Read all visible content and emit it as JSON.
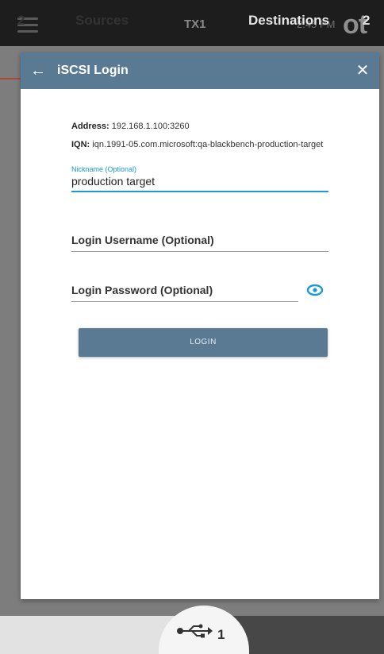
{
  "appbar": {
    "device_name": "TX1",
    "time": "2:45 PM",
    "logo_text": "ot"
  },
  "dialog": {
    "title": "iSCSI Login",
    "address_label": "Address:",
    "address_value": "192.168.1.100:3260",
    "iqn_label": "IQN:",
    "iqn_value": "iqn.1991-05.com.microsoft:qa-blackbench-production-target",
    "nickname": {
      "label": "Nickname (Optional)",
      "value": "production target"
    },
    "username": {
      "label": "Login Username (Optional)",
      "value": ""
    },
    "password": {
      "label": "Login Password (Optional)",
      "value": ""
    },
    "login_button": "LOGIN"
  },
  "bottombar": {
    "sources_count": "2",
    "sources_label": "Sources",
    "usb_count": "1",
    "destinations_label": "Destinations",
    "destinations_count": "2"
  },
  "icons": {
    "menu": "hamburger-icon",
    "back": "arrow-left-icon",
    "close": "close-icon",
    "reveal_password": "eye-icon",
    "usb": "usb-icon"
  },
  "colors": {
    "header": "#5a7a93",
    "accent": "#1a9ad6",
    "button": "#5a7a93"
  }
}
